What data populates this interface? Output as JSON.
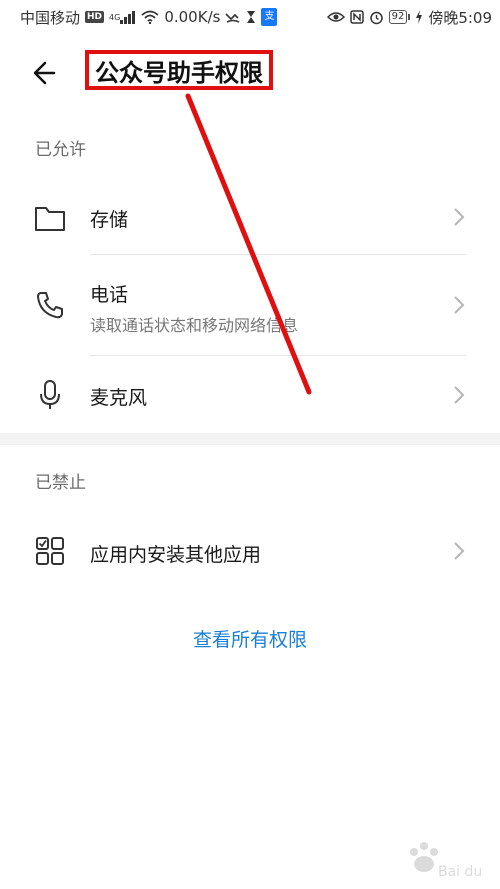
{
  "status_bar": {
    "carrier": "中国移动",
    "hd": "HD",
    "network": "4G",
    "speed": "0.00K/s",
    "battery": "92",
    "time": "傍晚5:09"
  },
  "header": {
    "title": "公众号助手权限"
  },
  "allowed": {
    "label": "已允许",
    "items": [
      {
        "title": "存储",
        "subtitle": "",
        "icon": "folder-icon"
      },
      {
        "title": "电话",
        "subtitle": "读取通话状态和移动网络信息",
        "icon": "phone-icon"
      },
      {
        "title": "麦克风",
        "subtitle": "",
        "icon": "microphone-icon"
      }
    ]
  },
  "denied": {
    "label": "已禁止",
    "items": [
      {
        "title": "应用内安装其他应用",
        "subtitle": "",
        "icon": "app-grid-icon"
      }
    ]
  },
  "view_all": "查看所有权限",
  "colors": {
    "accent": "#1a7fd6",
    "annotation": "#e01010",
    "section_label": "#6b6b6b"
  }
}
